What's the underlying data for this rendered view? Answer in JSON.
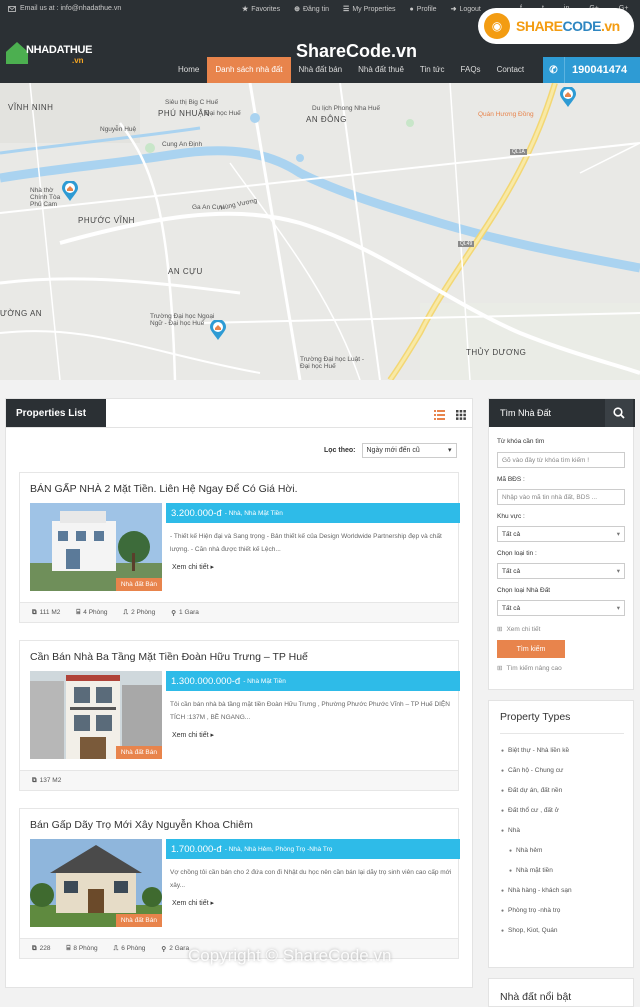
{
  "topbar": {
    "email": "Email us at : info@nhadathue.vn",
    "links": [
      "Favorites",
      "Đăng tin",
      "My Properties",
      "Profile",
      "Logout"
    ],
    "social": [
      "f",
      "t",
      "in",
      "G+",
      "G+"
    ]
  },
  "logo": {
    "name": "NHADATHUE",
    "suffix": ".vn"
  },
  "nav": {
    "items": [
      "Home",
      "Danh sách nhà đất",
      "Nhà đất bán",
      "Nhà đất thuê",
      "Tin tức",
      "FAQs",
      "Contact"
    ],
    "active": "Danh sách nhà đất",
    "phone": "190041474"
  },
  "watermark": {
    "top": "ShareCode.vn",
    "badge_a": "SHARE",
    "badge_b": "CODE",
    "badge_c": ".vn",
    "copyright": "Copyright © ShareCode.vn"
  },
  "map": {
    "labels": {
      "vinh_ninh": "VĨNH NINH",
      "phu_nhuan": "PHÚ NHUẬN",
      "an_dong": "AN ĐÔNG",
      "phuoc_vinh": "PHƯỚC VĨNH",
      "an_cuu": "AN CỰU",
      "thuy_duong": "THỦY DƯƠNG",
      "truong_an": "ƯỜNG AN",
      "bigc": "Siêu thị Big C Huế",
      "dhhue": "Đại học Huế",
      "dulich": "Du lịch Phong Nha Huế",
      "cungan": "Cung An Định",
      "gaancuu": "Ga An Cựu",
      "tdnn": "Trường Đại học Ngoại Ngữ - Đại học Huế",
      "tdluat": "Trường Đại học Luật - Đại học Huế",
      "quanhuong": "Quán Hương Đồng",
      "nhatho": "Nhà thờ Chính Tòa Phủ Cam",
      "hungvuong": "Hùng Vương",
      "nguyenhue": "Nguyễn Huệ",
      "ql49": "QL49",
      "ql1": "QL1A"
    }
  },
  "properties": {
    "title": "Properties List",
    "sort_label": "Lọc theo:",
    "sort_value": "Ngày mới đến cũ",
    "cards": [
      {
        "title": "BÁN GẤP NHÀ 2 Mặt Tiền. Liên Hệ Ngay Để Có Giá Hời.",
        "price": "3.200.000-đ",
        "ptype": "- Nhà, Nhà Mặt Tiền",
        "desc": "- Thiết kế Hiện đại và Sang trọng  - Bản thiết kế của Design Worldwide Partnership đẹp và chất lượng.  - Căn nhà được thiết kế Lệch...",
        "more": "Xem chi tiết",
        "tag": "Nhà đất Bán",
        "features": [
          "111 M2",
          "4 Phòng",
          "2 Phòng",
          "1 Gara"
        ]
      },
      {
        "title": "Cần Bán Nhà Ba Tầng Mặt Tiền Đoàn Hữu Trưng – TP Huế",
        "price": "1.300.000.000-đ",
        "ptype": "- Nhà Mặt Tiền",
        "desc": "Tôi cần bán nhà bà tầng mặt tiền Đoàn Hữu Trưng , Phường Phước Phước Vĩnh – TP Huế DIỆN TÍCH :137M , BỀ NGANG...",
        "more": "Xem chi tiết",
        "tag": "Nhà đất Bán",
        "features": [
          "137 M2"
        ]
      },
      {
        "title": "Bán Gấp Dãy Trọ Mới Xây Nguyễn Khoa Chiêm",
        "price": "1.700.000-đ",
        "ptype": "- Nhà, Nhà Hẻm, Phòng Trọ -Nhà Trọ",
        "desc": "Vợ chồng tôi cần bán cho 2 đứa con đi Nhật du học nên cần bán lại dãy trọ sinh viên cao cấp mới xây...",
        "more": "Xem chi tiết",
        "tag": "Nhà đất Bán",
        "features": [
          "228",
          "8 Phòng",
          "6 Phòng",
          "2 Gara"
        ]
      }
    ]
  },
  "search": {
    "title": "Tìm Nhà Đất",
    "keyword_label": "Từ khóa cần tìm",
    "keyword_placeholder": "Gõ vào đây từ khóa tìm kiếm !",
    "code_label": "Mã BĐS :",
    "code_placeholder": "Nhập vào mã tin nhà đất, BDS ...",
    "area_label": "Khu vực :",
    "area_value": "Tất cả",
    "type_label": "Chọn loại tin :",
    "type_value": "Tất cả",
    "kind_label": "Chọn loại Nhà Đất",
    "kind_value": "Tất cả",
    "view_all": "Xem chi tiết",
    "button": "Tìm kiếm",
    "advanced": "Tìm kiếm nâng cao"
  },
  "types": {
    "title": "Property Types",
    "items": [
      "Biệt thự - Nhà liền kề",
      "Căn hộ - Chung cư",
      "Đất dự án, đất nền",
      "Đất thổ cư , đất ở",
      "Nhà",
      "Nhà hẻm",
      "Nhà mặt tiền",
      "Nhà hàng - khách sạn",
      "Phòng trọ -nhà trọ",
      "Shop, Kiot, Quán"
    ]
  },
  "featured": {
    "title": "Nhà đất nổi bật"
  }
}
